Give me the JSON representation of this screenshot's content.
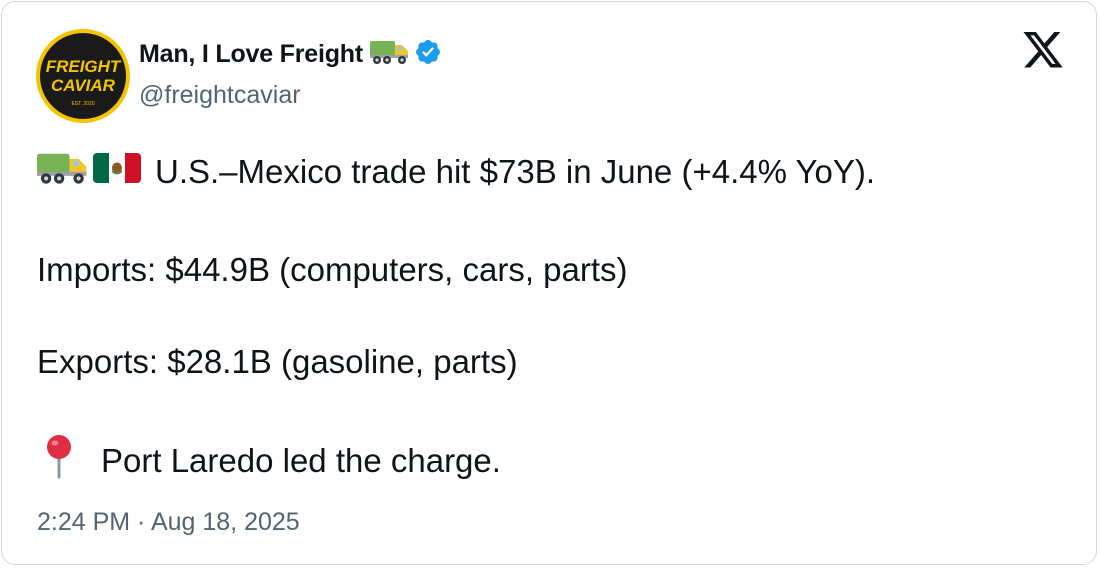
{
  "author": {
    "display_name": "Man, I Love Freight",
    "handle": "@freightcaviar",
    "avatar": {
      "line1": "FREIGHT",
      "line2": "CAVIAR",
      "est": "EST. 2020",
      "bg_color": "#1a1a1a",
      "ring_color": "#f5c400",
      "text_color": "#f5c400"
    },
    "verified_badge_color": "#1d9bf0",
    "name_emoji": "truck-icon"
  },
  "platform_logo": "x-logo",
  "tweet": {
    "line1": "U.S.–Mexico trade hit $73B in June (+4.4% YoY).",
    "line1_emojis": [
      "truck-icon",
      "mexico-flag-icon"
    ],
    "line2": "Imports: $44.9B (computers, cars, parts)",
    "line3": "Exports: $28.1B (gasoline, parts)",
    "line4": "Port Laredo led the charge.",
    "line4_emoji": "round-pushpin-icon"
  },
  "timestamp": "2:24 PM · Aug 18, 2025",
  "colors": {
    "text_primary": "#0f1419",
    "text_secondary": "#536471",
    "border": "#cfd9de"
  }
}
